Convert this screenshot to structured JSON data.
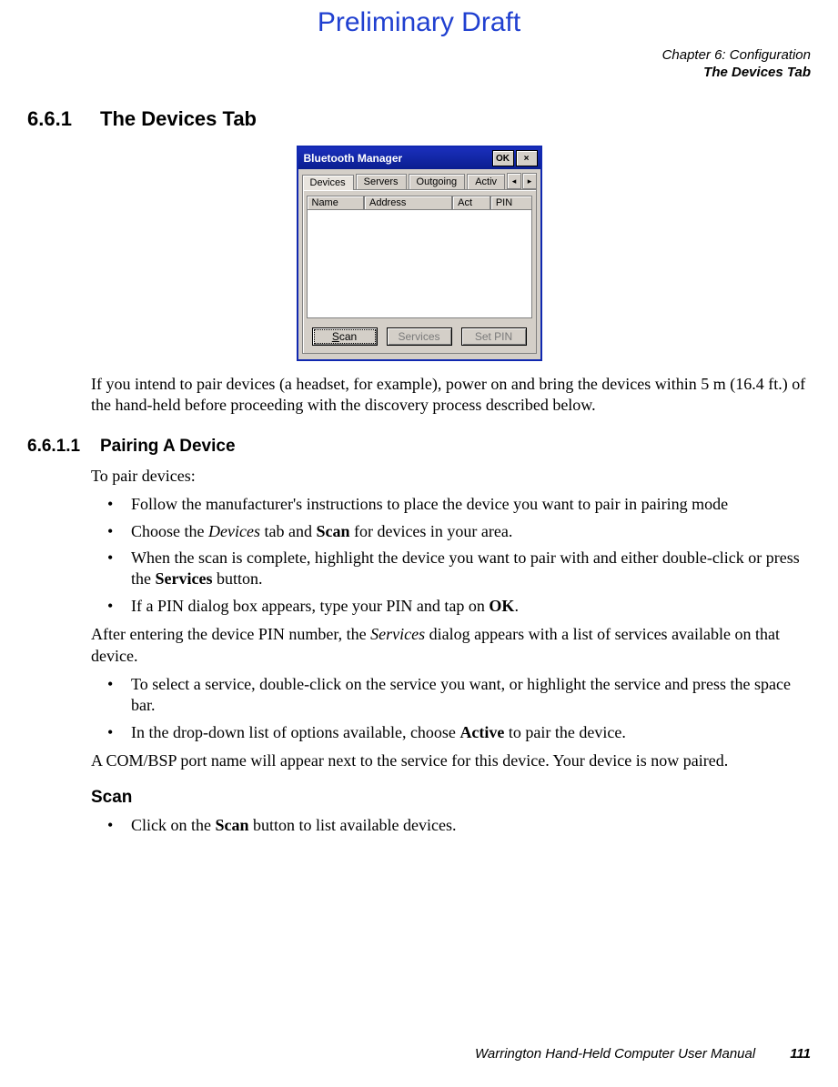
{
  "watermark": "Preliminary Draft",
  "header": {
    "chapter": "Chapter 6: Configuration",
    "section": "The Devices Tab"
  },
  "section_661": {
    "num": "6.6.1",
    "title": "The Devices Tab"
  },
  "win": {
    "title": "Bluetooth Manager",
    "ok": "OK",
    "close": "×",
    "tabs": [
      "Devices",
      "Servers",
      "Outgoing",
      "Activ"
    ],
    "nav_left": "◂",
    "nav_right": "▸",
    "cols": {
      "name": "Name",
      "address": "Address",
      "act": "Act",
      "pin": "PIN"
    },
    "btns": {
      "scan": "Scan",
      "services": "Services",
      "setpin": "Set PIN"
    }
  },
  "p_intro": "If you intend to pair devices (a headset, for example), power on and bring the devices within 5 m (16.4 ft.) of the hand-held before proceeding with the discovery process described below.",
  "section_6611": {
    "num": "6.6.1.1",
    "title": "Pairing A Device"
  },
  "p_topair": "To pair devices:",
  "b1": "Follow the manufacturer's instructions to place the device you want to pair in pairing mode",
  "b2a": "Choose the ",
  "b2b": "Devices",
  "b2c": " tab and ",
  "b2d": "Scan",
  "b2e": " for devices in your area.",
  "b3a": "When the scan is complete, highlight the device you want to pair with and either double-click or press the ",
  "b3b": "Services",
  "b3c": " button.",
  "b4a": "If a PIN dialog box appears, type your PIN and tap on ",
  "b4b": "OK",
  "b4c": ".",
  "p_after_pin_a": "After entering the device PIN number, the ",
  "p_after_pin_b": "Services",
  "p_after_pin_c": " dialog appears with a list of services available on that device.",
  "b5": "To select a service, double-click on the service you want, or highlight the service and press the space bar.",
  "b6a": "In the drop-down list of options available, choose ",
  "b6b": "Active",
  "b6c": " to pair the device.",
  "p_com": "A COM/BSP port name will appear next to the service for this device. Your device is now paired.",
  "h_scan": "Scan",
  "b7a": "Click on the ",
  "b7b": "Scan",
  "b7c": " button to list available devices.",
  "footer": {
    "manual": "Warrington Hand-Held Computer User Manual",
    "page": "111"
  }
}
